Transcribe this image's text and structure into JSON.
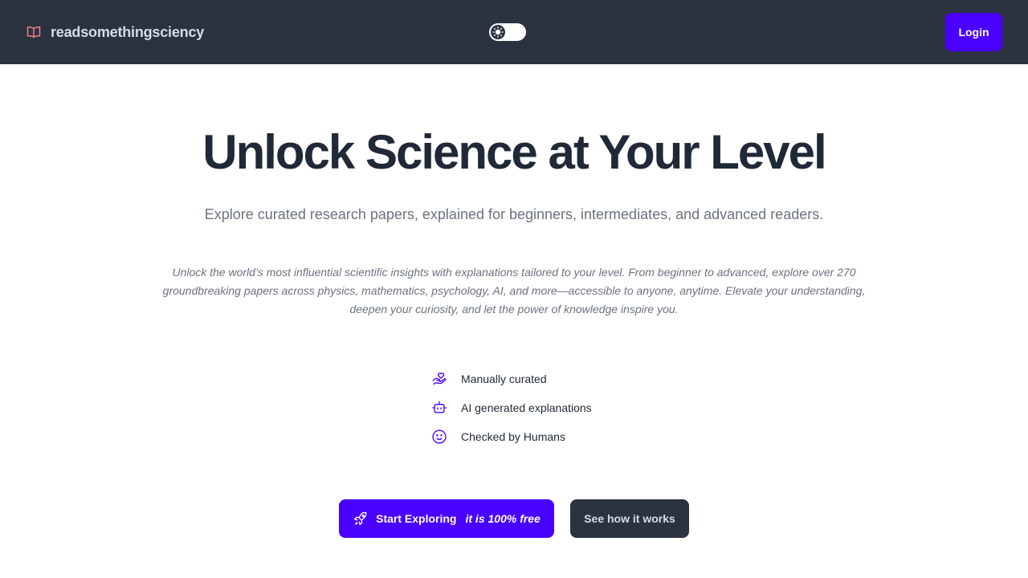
{
  "navbar": {
    "brand_name": "readsomethingsciency",
    "brand_icon": "open-book-icon",
    "theme_toggle_icon": "sun-icon",
    "login_label": "Login"
  },
  "hero": {
    "title": "Unlock Science at Your Level",
    "subtitle": "Explore curated research papers, explained for beginners, intermediates, and advanced readers.",
    "description": "Unlock the world’s most influential scientific insights with explanations tailored to your level. From beginner to advanced, explore over 270 groundbreaking papers across physics, mathematics, psychology, AI, and more—accessible to anyone, anytime. Elevate your understanding, deepen your curiosity, and let the power of knowledge inspire you."
  },
  "features": [
    {
      "icon": "hand-heart-icon",
      "label": "Manually curated"
    },
    {
      "icon": "robot-icon",
      "label": "AI generated explanations"
    },
    {
      "icon": "smiley-face-icon",
      "label": "Checked by Humans"
    }
  ],
  "cta": {
    "primary_label": "Start Exploring",
    "primary_tag": "it is 100% free",
    "primary_icon": "rocket-icon",
    "secondary_label": "See how it works"
  },
  "colors": {
    "navbar_bg": "#2b3240",
    "accent": "#4a00ff",
    "brand_icon": "#f0828a",
    "title": "#1f2937",
    "muted_text": "#6b7280"
  }
}
